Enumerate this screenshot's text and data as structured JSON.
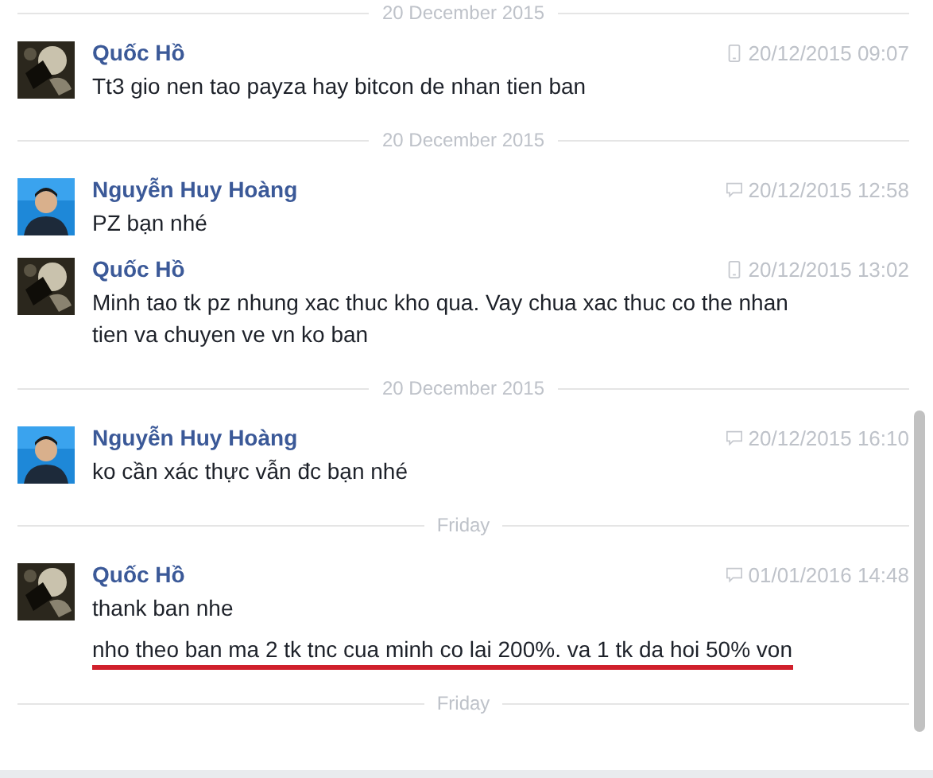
{
  "thread": [
    {
      "kind": "divider",
      "label": "20 December 2015"
    },
    {
      "kind": "message",
      "sender": "Quốc Hồ",
      "avatar": {
        "kind": "dark"
      },
      "via": {
        "kind": "mobile"
      },
      "time": "20/12/2015 09:07",
      "texts": [
        {
          "text": "Tt3 gio nen tao payza hay bitcon de nhan tien ban",
          "underlined": false
        }
      ]
    },
    {
      "kind": "divider",
      "label": "20 December 2015"
    },
    {
      "kind": "message",
      "sender": "Nguyễn Huy Hoàng",
      "avatar": {
        "kind": "blue"
      },
      "via": {
        "kind": "chat"
      },
      "time": "20/12/2015 12:58",
      "texts": [
        {
          "text": "PZ bạn nhé",
          "underlined": false
        }
      ]
    },
    {
      "kind": "message",
      "sender": "Quốc Hồ",
      "avatar": {
        "kind": "dark"
      },
      "via": {
        "kind": "mobile"
      },
      "time": "20/12/2015 13:02",
      "texts": [
        {
          "text": "Minh tao tk pz nhung xac thuc kho qua. Vay chua xac thuc co the nhan tien va chuyen ve vn ko ban",
          "underlined": false
        }
      ]
    },
    {
      "kind": "divider",
      "label": "20 December 2015"
    },
    {
      "kind": "message",
      "sender": "Nguyễn Huy Hoàng",
      "avatar": {
        "kind": "blue"
      },
      "via": {
        "kind": "chat"
      },
      "time": "20/12/2015 16:10",
      "texts": [
        {
          "text": "ko cần xác thực vẫn đc bạn nhé",
          "underlined": false
        }
      ]
    },
    {
      "kind": "divider",
      "label": "Friday"
    },
    {
      "kind": "message",
      "sender": "Quốc Hồ",
      "avatar": {
        "kind": "dark"
      },
      "via": {
        "kind": "chat"
      },
      "time": "01/01/2016 14:48",
      "texts": [
        {
          "text": "thank ban nhe",
          "underlined": false
        },
        {
          "text": "nho theo ban ma 2 tk tnc cua minh co lai 200%. va 1 tk da hoi 50% von",
          "underlined": true
        }
      ]
    },
    {
      "kind": "divider",
      "label": "Friday"
    }
  ]
}
